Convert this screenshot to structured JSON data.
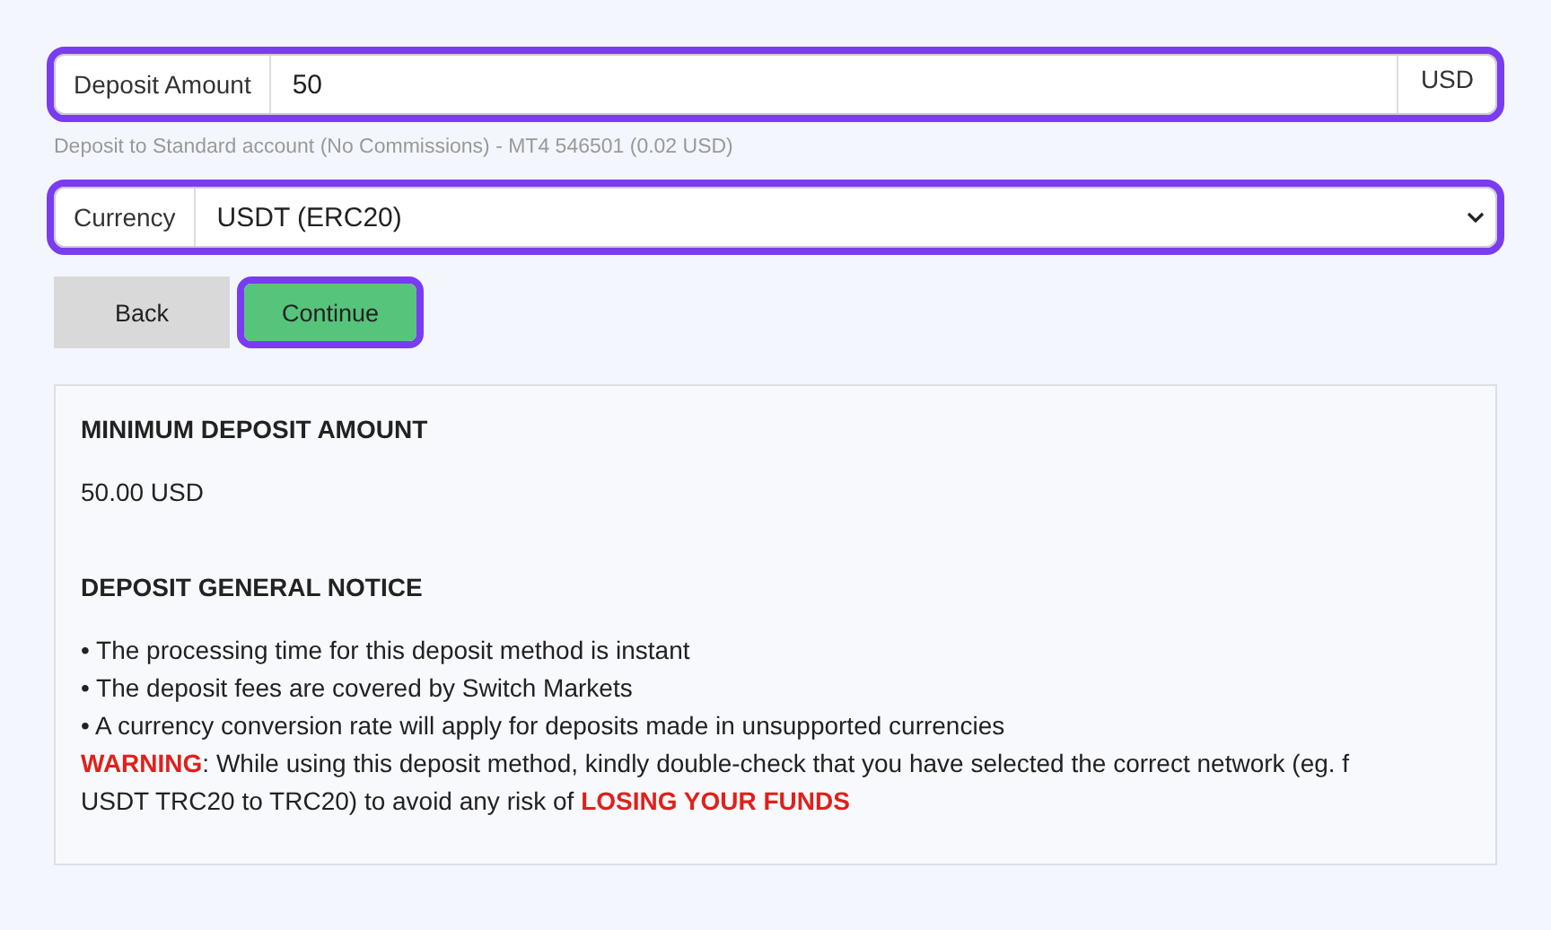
{
  "amount_field": {
    "label": "Deposit Amount",
    "value": "50",
    "suffix": "USD",
    "highlighted": true
  },
  "account_note": "Deposit to Standard account (No Commissions) - MT4 546501 (0.02 USD)",
  "currency_field": {
    "label": "Currency",
    "value": "USDT (ERC20)",
    "highlighted": true
  },
  "buttons": [
    {
      "label": "Back",
      "kind": "secondary",
      "highlighted": false
    },
    {
      "label": "Continue",
      "kind": "primary",
      "highlighted": true
    }
  ],
  "info_panel": {
    "sections": [
      {
        "heading": "MINIMUM DEPOSIT AMOUNT",
        "lines": [
          "50.00 USD"
        ]
      },
      {
        "heading": "DEPOSIT GENERAL NOTICE",
        "lines": [
          "• The processing time for this deposit method is instant",
          "• The deposit fees are covered by Switch Markets",
          "• A currency conversion rate will apply for deposits made in unsupported currencies",
          "**WARNING**: While using this deposit method, kindly double-check that you have selected the correct network (eg. f",
          "USDT TRC20 to TRC20) to avoid any risk of **LOSING YOUR FUNDS**"
        ]
      }
    ]
  }
}
